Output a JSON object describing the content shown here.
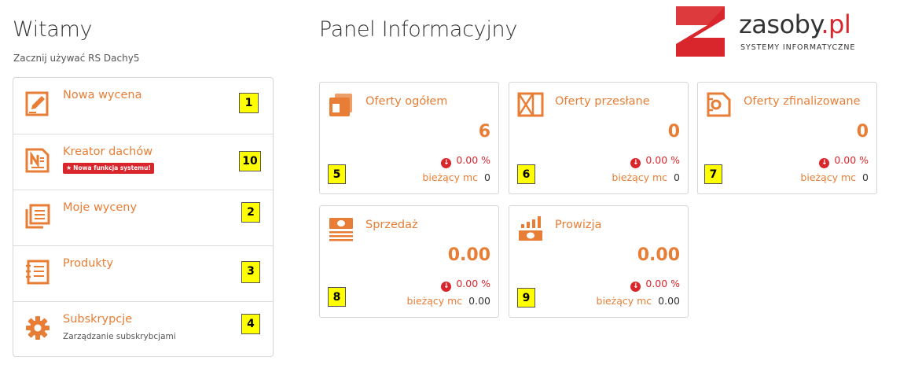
{
  "welcome": {
    "title": "Witamy",
    "subtitle": "Zacznij używać RS Dachy5"
  },
  "menu": {
    "items": [
      {
        "label": "Nowa wycena",
        "icon": "edit-document-icon",
        "badge_number": "1"
      },
      {
        "label": "Kreator dachów",
        "icon": "document-n-icon",
        "badge_number": "10",
        "feature_badge": "Nowa funkcja systemu!"
      },
      {
        "label": "Moje wyceny",
        "icon": "documents-stack-icon",
        "badge_number": "2"
      },
      {
        "label": "Produkty",
        "icon": "product-list-icon",
        "badge_number": "3"
      },
      {
        "label": "Subskrypcje",
        "icon": "gear-icon",
        "badge_number": "4",
        "sublabel": "Zarządzanie subskrybcjami"
      }
    ]
  },
  "panel": {
    "title": "Panel Informacyjny"
  },
  "logo": {
    "name": "zasoby",
    "suffix": ".pl",
    "tagline": "SYSTEMY INFORMATYCZNE",
    "brand_color": "#d9262c"
  },
  "cards": [
    {
      "title": "Oferty ogółem",
      "icon": "offers-all-icon",
      "value": "6",
      "change": "0.00 %",
      "month_label": "bieżący mc",
      "month_value": "0",
      "badge_number": "5"
    },
    {
      "title": "Oferty przesłane",
      "icon": "offers-sent-icon",
      "value": "0",
      "change": "0.00 %",
      "month_label": "bieżący mc",
      "month_value": "0",
      "badge_number": "6"
    },
    {
      "title": "Oferty zfinalizowane",
      "icon": "offers-finalized-icon",
      "value": "0",
      "change": "0.00 %",
      "month_label": "bieżący mc",
      "month_value": "0",
      "badge_number": "7"
    },
    {
      "title": "Sprzedaż",
      "icon": "sales-money-icon",
      "value": "0.00",
      "change": "0.00 %",
      "month_label": "bieżący mc",
      "month_value": "0.00",
      "badge_number": "8"
    },
    {
      "title": "Prowizja",
      "icon": "commission-chart-icon",
      "value": "0.00",
      "change": "0.00 %",
      "month_label": "bieżący mc",
      "month_value": "0.00",
      "badge_number": "9"
    }
  ],
  "colors": {
    "accent": "#e87e35",
    "negative": "#d9262c",
    "badge_yellow": "#ffff00"
  }
}
